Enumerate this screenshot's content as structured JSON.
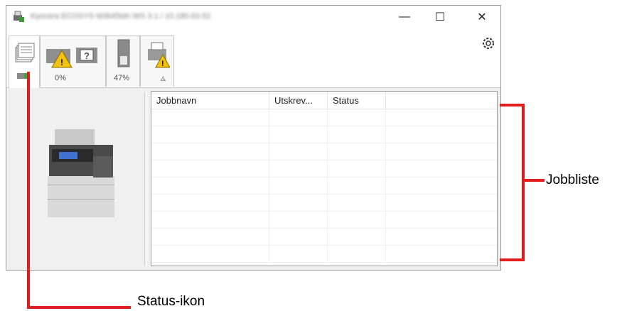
{
  "window": {
    "title": "Kyocera ECOSYS M3645idn WS 3.1 / 10.180.63.52",
    "minimize_glyph": "—",
    "maximize_glyph": "☐",
    "close_glyph": "✕"
  },
  "toolbar": {
    "tabs": [
      {
        "name": "job-list-tab",
        "label": ""
      },
      {
        "name": "toner-status-tab",
        "label": "0%"
      },
      {
        "name": "paper-level-tab",
        "label": "47%"
      },
      {
        "name": "device-warning-tab",
        "label": ""
      }
    ],
    "collapse_glyph": "◬",
    "settings_icon": "gear-icon"
  },
  "job_list": {
    "columns": [
      "Jobbnavn",
      "Utskrev...",
      "Status",
      ""
    ],
    "row_count_visible": 9
  },
  "annotations": {
    "job_list_label": "Jobbliste",
    "status_icon_label": "Status-ikon",
    "callout_color": "#e11d1d"
  }
}
